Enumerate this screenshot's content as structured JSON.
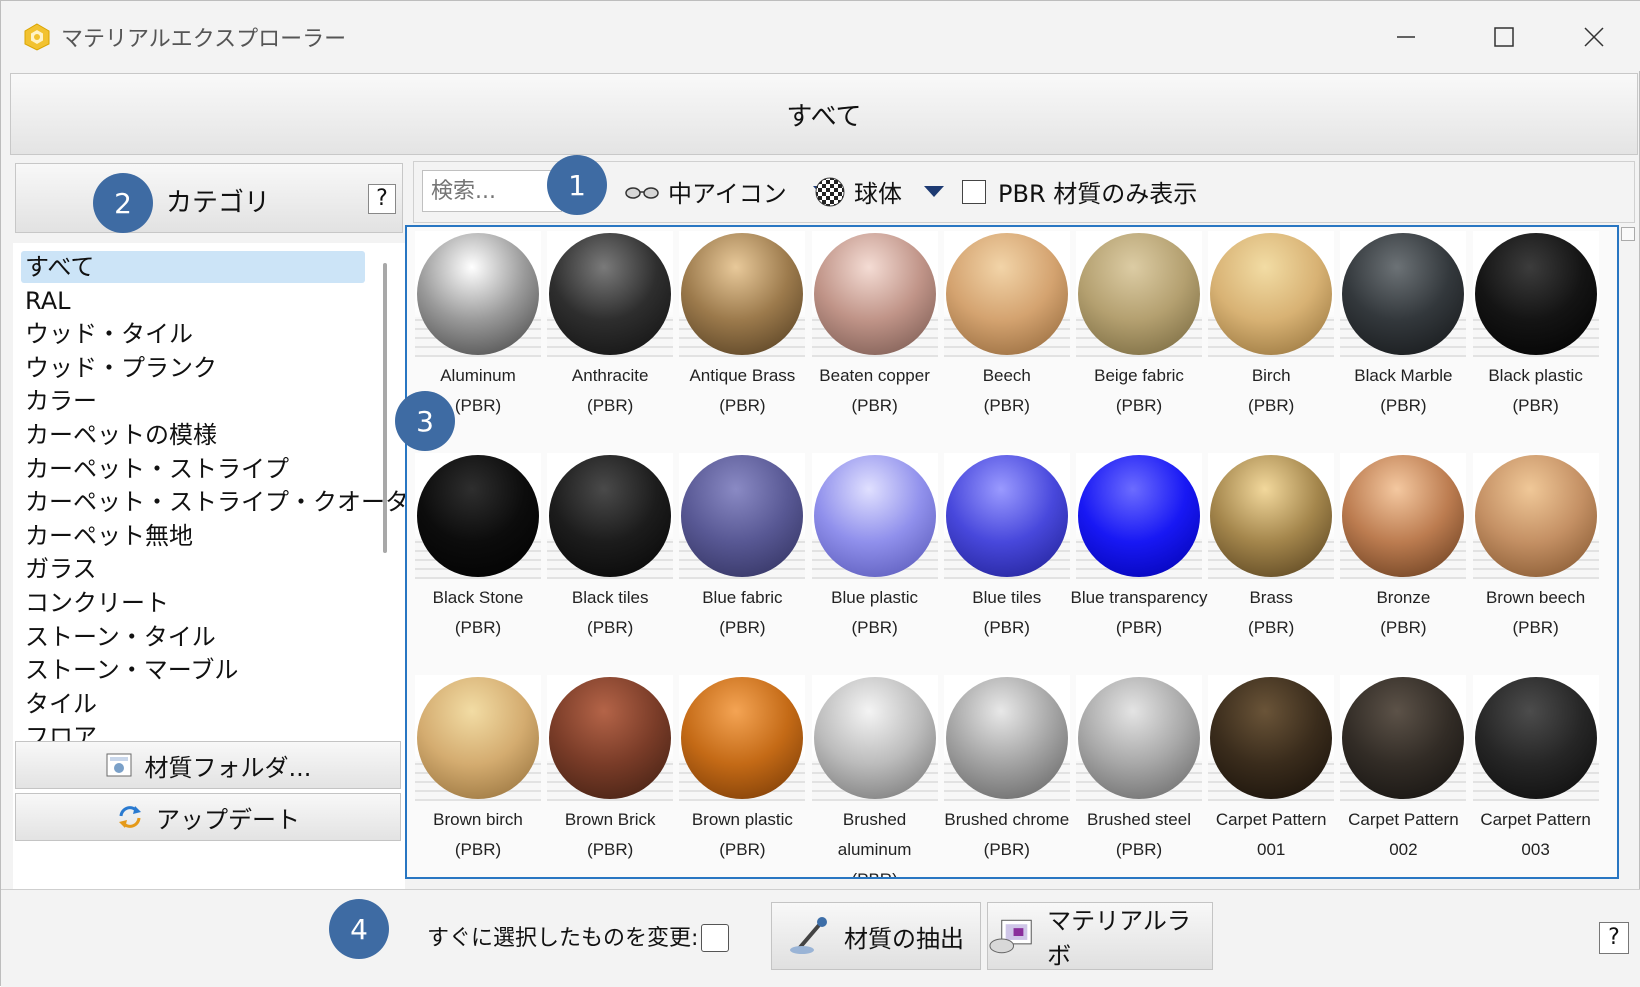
{
  "window": {
    "title": "マテリアルエクスプローラー",
    "minimize": "—",
    "maximize": "☐",
    "close": "✕"
  },
  "top_tab": "すべて",
  "category": {
    "header": "カテゴリ",
    "help": "?",
    "items": [
      "すべて",
      "RAL",
      "ウッド・タイル",
      "ウッド・プランク",
      "カラー",
      "カーペットの模様",
      "カーペット・ストライプ",
      "カーペット・ストライプ・クオーター",
      "カーペット無地",
      "ガラス",
      "コンクリート",
      "ストーン・タイル",
      "ストーン・マーブル",
      "タイル",
      "フロア"
    ],
    "selected_index": 0,
    "folder_button": "材質フォルダ...",
    "update_button": "アップデート"
  },
  "toolbar": {
    "search_placeholder": "検索...",
    "icon_size": "中アイコン",
    "shape": "球体",
    "pbr_only_label": "PBR 材質のみ表示",
    "pbr_only_checked": false
  },
  "materials": [
    {
      "name": "Aluminum",
      "sub": "(PBR)",
      "c1": "#ffffff",
      "c2": "#9a9a9a",
      "c3": "#3c3c3c"
    },
    {
      "name": "Anthracite",
      "sub": "(PBR)",
      "c1": "#7a7a7a",
      "c2": "#2e2e2e",
      "c3": "#0e0e0e"
    },
    {
      "name": "Antique Brass",
      "sub": "(PBR)",
      "c1": "#e8c99a",
      "c2": "#9c7a4c",
      "c3": "#4a361c"
    },
    {
      "name": "Beaten copper",
      "sub": "(PBR)",
      "c1": "#f4dcd4",
      "c2": "#c09488",
      "c3": "#6e5048"
    },
    {
      "name": "Beech",
      "sub": "(PBR)",
      "c1": "#f2d4a8",
      "c2": "#d4a370",
      "c3": "#8a6034"
    },
    {
      "name": "Beige fabric",
      "sub": "(PBR)",
      "c1": "#dccca4",
      "c2": "#b4a070",
      "c3": "#6e6038"
    },
    {
      "name": "Birch",
      "sub": "(PBR)",
      "c1": "#f2dca4",
      "c2": "#d8b274",
      "c3": "#8c6a34"
    },
    {
      "name": "Black Marble",
      "sub": "(PBR)",
      "c1": "#6c7276",
      "c2": "#33383c",
      "c3": "#121416"
    },
    {
      "name": "Black plastic",
      "sub": "(PBR)",
      "c1": "#3c3c3c",
      "c2": "#141414",
      "c3": "#000000"
    },
    {
      "name": "Black Stone",
      "sub": "(PBR)",
      "c1": "#2e2e2e",
      "c2": "#0c0c0c",
      "c3": "#000000"
    },
    {
      "name": "Black tiles",
      "sub": "(PBR)",
      "c1": "#4a4a4a",
      "c2": "#1c1c1c",
      "c3": "#040404"
    },
    {
      "name": "Blue fabric",
      "sub": "(PBR)",
      "c1": "#8a8ac4",
      "c2": "#585894",
      "c3": "#2c2c58"
    },
    {
      "name": "Blue plastic",
      "sub": "(PBR)",
      "c1": "#e0e0ff",
      "c2": "#9090ec",
      "c3": "#5050b0"
    },
    {
      "name": "Blue tiles",
      "sub": "(PBR)",
      "c1": "#9a9aff",
      "c2": "#4848dc",
      "c3": "#1c1c8c"
    },
    {
      "name": "Blue transparency",
      "sub": "(PBR)",
      "c1": "#6c6cff",
      "c2": "#1818f4",
      "c3": "#0000a8"
    },
    {
      "name": "Brass",
      "sub": "(PBR)",
      "c1": "#f2d89c",
      "c2": "#a4864c",
      "c3": "#4c3818"
    },
    {
      "name": "Bronze",
      "sub": "(PBR)",
      "c1": "#f4c8a0",
      "c2": "#bc7c50",
      "c3": "#5c3418"
    },
    {
      "name": "Brown beech",
      "sub": "(PBR)",
      "c1": "#f0c898",
      "c2": "#c49064",
      "c3": "#7a4e28"
    },
    {
      "name": "Brown birch",
      "sub": "(PBR)",
      "c1": "#f2dca4",
      "c2": "#d4ac70",
      "c3": "#8c6834"
    },
    {
      "name": "Brown Brick",
      "sub": "(PBR)",
      "c1": "#b46448",
      "c2": "#7a3c28",
      "c3": "#3a1c10"
    },
    {
      "name": "Brown plastic",
      "sub": "(PBR)",
      "c1": "#f4a454",
      "c2": "#c46a16",
      "c3": "#6e3404"
    },
    {
      "name": "Brushed aluminum",
      "sub": "(PBR)",
      "c1": "#f4f4f4",
      "c2": "#bcbcbc",
      "c3": "#6c6c6c"
    },
    {
      "name": "Brushed chrome",
      "sub": "(PBR)",
      "c1": "#e8e8e8",
      "c2": "#a4a4a4",
      "c3": "#5c5c5c"
    },
    {
      "name": "Brushed steel",
      "sub": "(PBR)",
      "c1": "#e4e4e4",
      "c2": "#a8a8a8",
      "c3": "#606060"
    },
    {
      "name": "Carpet Pattern 001",
      "sub": "",
      "c1": "#6a5438",
      "c2": "#3a2c1c",
      "c3": "#140e08"
    },
    {
      "name": "Carpet Pattern 002",
      "sub": "",
      "c1": "#5c5248",
      "c2": "#322c26",
      "c3": "#12100e"
    },
    {
      "name": "Carpet Pattern 003",
      "sub": "",
      "c1": "#4c4c4c",
      "c2": "#262626",
      "c3": "#0a0a0a"
    }
  ],
  "bottom": {
    "auto_change_label": "すぐに選択したものを変更:",
    "auto_change_checked": false,
    "extract_button": "材質の抽出",
    "lab_button": "マテリアルラボ",
    "help": "?"
  },
  "callouts": [
    "1",
    "2",
    "3",
    "4"
  ],
  "colors": {
    "accent": "#2876c2",
    "badge": "#3e6ba3",
    "caret": "#1d3a72",
    "selection": "#cce4f7"
  }
}
